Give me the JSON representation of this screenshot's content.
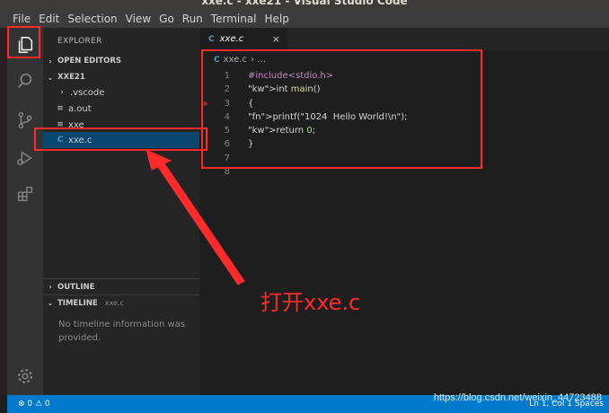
{
  "window": {
    "title": "xxe.c - xxe21 - Visual Studio Code"
  },
  "menu": [
    "File",
    "Edit",
    "Selection",
    "View",
    "Go",
    "Run",
    "Terminal",
    "Help"
  ],
  "activity_bar": [
    "explorer-icon",
    "search-icon",
    "source-control-icon",
    "run-debug-icon",
    "extensions-icon",
    "settings-gear-icon"
  ],
  "sidebar": {
    "title": "EXPLORER",
    "open_editors": "OPEN EDITORS",
    "folder": "XXE21",
    "files": [
      {
        "name": ".vscode",
        "icon": "›"
      },
      {
        "name": "a.out",
        "icon": "≡"
      },
      {
        "name": "xxe",
        "icon": "≡"
      },
      {
        "name": "xxe.c",
        "icon": "C"
      }
    ],
    "outline": "OUTLINE",
    "timeline": "TIMELINE",
    "timeline_file": "xxe.c",
    "timeline_msg": "No timeline information was provided."
  },
  "editor": {
    "tab": "xxe.c",
    "tab_icon": "C",
    "close": "×",
    "breadcrumb": "xxe.c",
    "breadcrumb_rest": "› …",
    "lines": [
      {
        "n": "1",
        "text": "#include<stdio.h>"
      },
      {
        "n": "2",
        "text": "int main()"
      },
      {
        "n": "3",
        "text": "{"
      },
      {
        "n": "4",
        "text": "printf(\"1024  Hello World!\\n\");"
      },
      {
        "n": "5",
        "text": "return 0;"
      },
      {
        "n": "6",
        "text": "}"
      },
      {
        "n": "7",
        "text": ""
      },
      {
        "n": "8",
        "text": ""
      }
    ]
  },
  "status": {
    "left": "⊗ 0  ⚠ 0",
    "right": "Ln 1, Col 1    Spaces"
  },
  "annotation": "打开xxe.c",
  "watermark": "https://blog.csdn.net/weixin_44723488",
  "colors": {
    "annotation": "#ff2a2a",
    "statusbar": "#007acc",
    "selection": "#094771"
  }
}
